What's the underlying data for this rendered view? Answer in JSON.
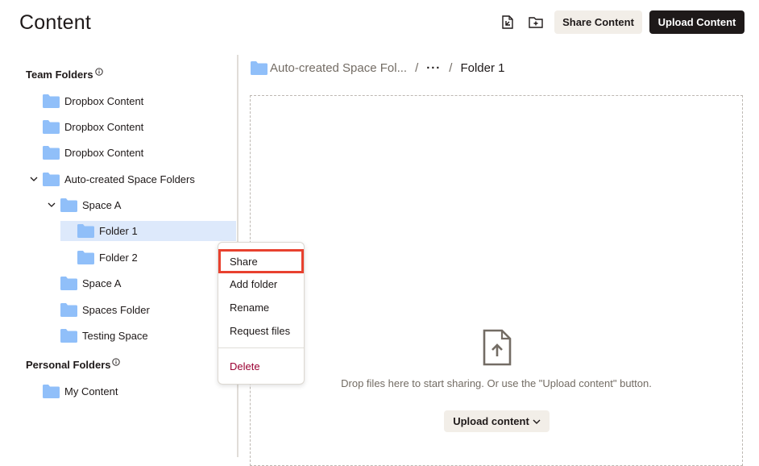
{
  "header": {
    "title": "Content",
    "share_label": "Share Content",
    "upload_label": "Upload Content",
    "icons": [
      "new-file-icon",
      "new-folder-icon"
    ]
  },
  "sidebar": {
    "team_heading": "Team Folders",
    "personal_heading": "Personal Folders",
    "team_items": [
      {
        "label": "Dropbox Content"
      },
      {
        "label": "Dropbox Content"
      },
      {
        "label": "Dropbox Content"
      },
      {
        "label": "Auto-created Space Folders",
        "expanded": true
      },
      {
        "label": "Space A",
        "expanded": true
      },
      {
        "label": "Folder 1",
        "selected": true
      },
      {
        "label": "Folder 2"
      },
      {
        "label": "Space A"
      },
      {
        "label": "Spaces Folder"
      },
      {
        "label": "Testing Space"
      }
    ],
    "personal_items": [
      {
        "label": "My Content"
      }
    ]
  },
  "context_menu": {
    "items": [
      {
        "label": "Share",
        "highlighted": true
      },
      {
        "label": "Add folder"
      },
      {
        "label": "Rename"
      },
      {
        "label": "Request files"
      },
      {
        "label": "Delete",
        "danger": true
      }
    ]
  },
  "breadcrumb": {
    "root": "Auto-created Space Fol...",
    "ellipsis": "···",
    "current": "Folder 1",
    "separator": "/"
  },
  "dropzone": {
    "message": "Drop files here to start sharing. Or use the \"Upload content\" button.",
    "button_label": "Upload content"
  },
  "colors": {
    "folder": "#90bff9",
    "selected_row": "#dde9fb",
    "primary_button": "#1e1919",
    "secondary_button": "#f2eee8",
    "highlight_border": "#e8412f",
    "danger_text": "#9b0032"
  }
}
